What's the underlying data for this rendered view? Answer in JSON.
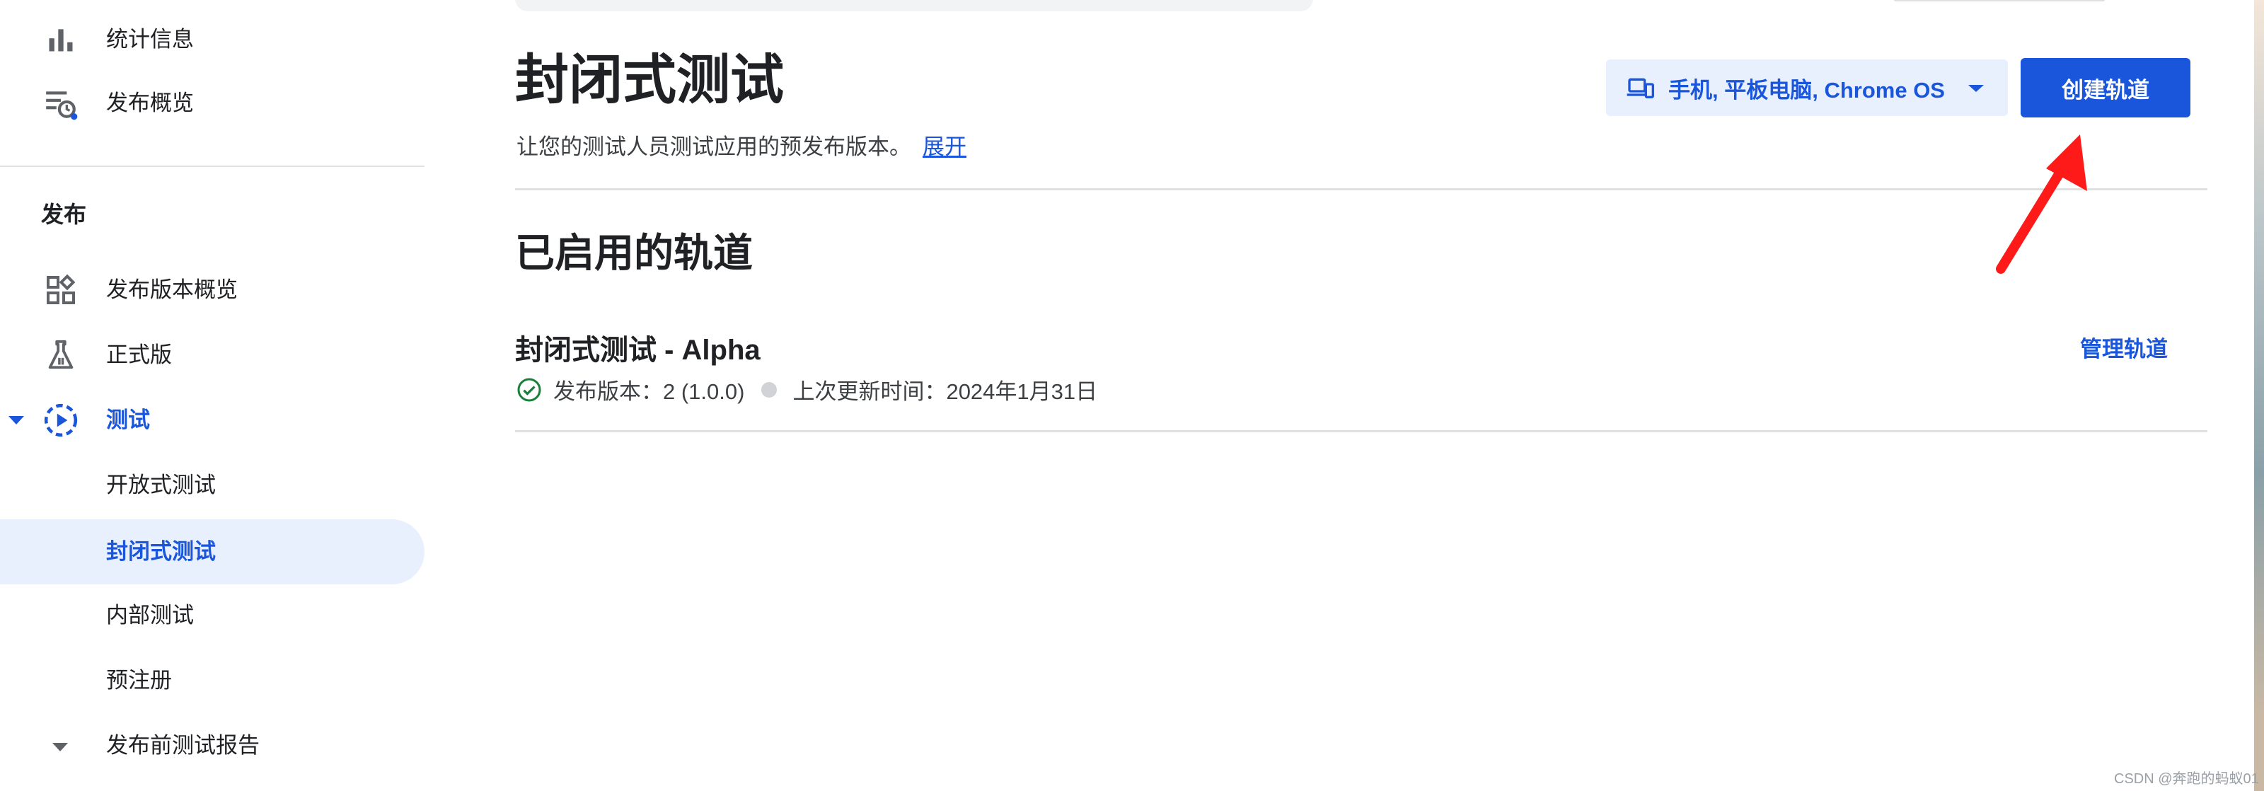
{
  "sidebar": {
    "top_items": [
      {
        "label": "统计信息",
        "icon": "bar-chart-icon"
      },
      {
        "label": "发布概览",
        "icon": "release-overview-icon"
      }
    ],
    "section_title": "发布",
    "items": [
      {
        "label": "发布版本概览",
        "icon": "dashboard-icon"
      },
      {
        "label": "正式版",
        "icon": "production-icon"
      },
      {
        "label": "测试",
        "icon": "testing-icon"
      },
      {
        "label": "开放式测试"
      },
      {
        "label": "封闭式测试"
      },
      {
        "label": "内部测试"
      },
      {
        "label": "预注册"
      },
      {
        "label": "发布前测试报告",
        "icon": "chevron-down-icon"
      }
    ]
  },
  "main": {
    "title": "封闭式测试",
    "subtitle": "让您的测试人员测试应用的预发布版本。",
    "expand_link": "展开",
    "device_selector": "手机, 平板电脑, Chrome OS",
    "create_button": "创建轨道",
    "section_heading": "已启用的轨道",
    "track": {
      "name": "封闭式测试 - Alpha",
      "release": "发布版本：2 (1.0.0)",
      "updated": "上次更新时间：2024年1月31日",
      "manage_link": "管理轨道"
    }
  },
  "watermark": "CSDN @奔跑的蚂蚁01",
  "colors": {
    "accent": "#1a56db",
    "active_bg": "#e8f0fe",
    "annotation_arrow": "#ff1a1a",
    "status_ok": "#188038"
  }
}
